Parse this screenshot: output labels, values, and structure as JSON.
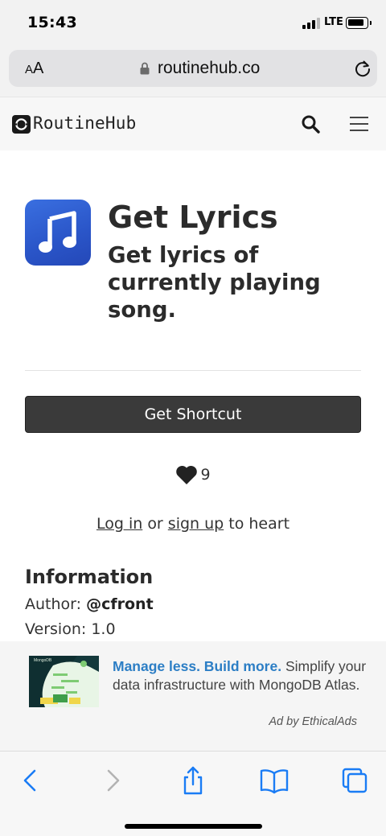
{
  "status_bar": {
    "time": "15:43",
    "network": "LTE"
  },
  "browser": {
    "text_size_small": "A",
    "text_size_big": "A",
    "url": "routinehub.co"
  },
  "site": {
    "brand": "RoutineHub"
  },
  "shortcut": {
    "title": "Get Lyrics",
    "subtitle": "Get lyrics of currently playing song.",
    "get_button": "Get Shortcut",
    "hearts": "9",
    "login_link": "Log in",
    "or_text": "or",
    "signup_link": "sign up",
    "to_heart_text": "to heart"
  },
  "information": {
    "heading": "Information",
    "author_label": "Author:",
    "author_value": "@cfront",
    "version_label": "Version:",
    "version_value": "1.0"
  },
  "ad": {
    "headline": "Manage less. Build more.",
    "body": "Simplify your data infrastructure with MongoDB Atlas.",
    "credit": "Ad by EthicalAds",
    "image_label": "MongoDB"
  },
  "colors": {
    "accent_link": "#2c7ec5",
    "button_bg": "#3a3a3a",
    "safari_blue": "#1a7cf5"
  },
  "icons": [
    "lock-icon",
    "reload-icon",
    "search-icon",
    "menu-icon",
    "music-note-icon",
    "heart-icon",
    "back-icon",
    "forward-icon",
    "share-icon",
    "bookmarks-icon",
    "tabs-icon"
  ]
}
